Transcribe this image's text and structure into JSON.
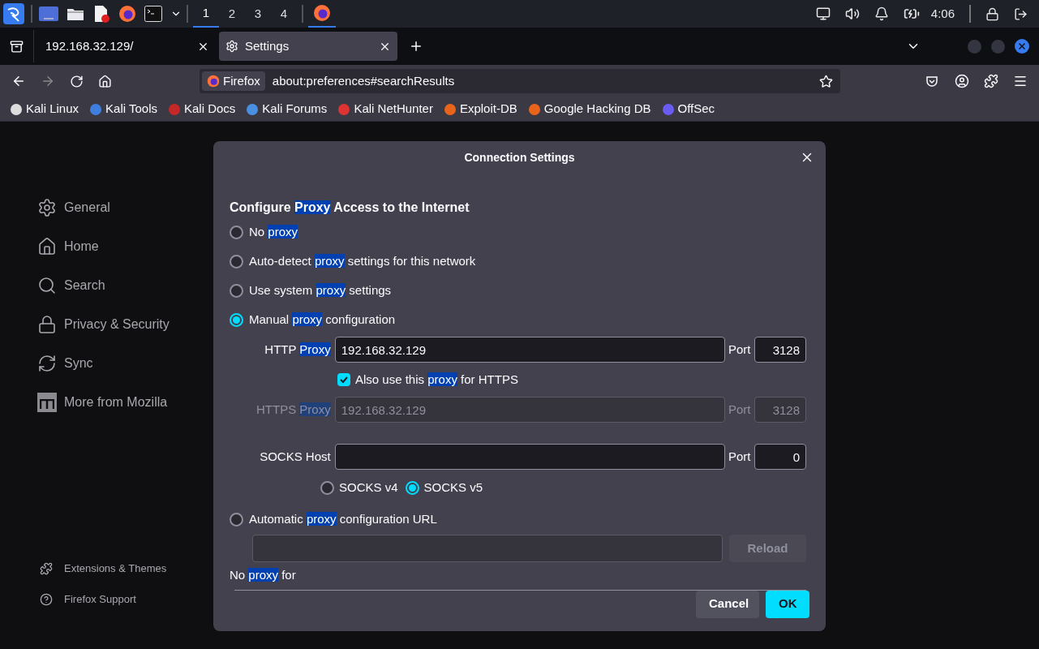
{
  "taskbar": {
    "workspaces": [
      {
        "label": "1",
        "selected": true
      },
      {
        "label": "2",
        "selected": false
      },
      {
        "label": "3",
        "selected": false
      },
      {
        "label": "4",
        "selected": false
      }
    ],
    "clock": "4:06"
  },
  "tabs": [
    {
      "title": "192.168.32.129/",
      "selected": false,
      "kind": "page"
    },
    {
      "title": "Settings",
      "selected": true,
      "kind": "settings"
    }
  ],
  "urlbar": {
    "identity": "Firefox",
    "url": "about:preferences#searchResults"
  },
  "bookmarks": [
    {
      "label": "Kali Linux"
    },
    {
      "label": "Kali Tools"
    },
    {
      "label": "Kali Docs"
    },
    {
      "label": "Kali Forums"
    },
    {
      "label": "Kali NetHunter"
    },
    {
      "label": "Exploit-DB"
    },
    {
      "label": "Google Hacking DB"
    },
    {
      "label": "OffSec"
    }
  ],
  "sidebar": {
    "items": [
      {
        "label": "General"
      },
      {
        "label": "Home"
      },
      {
        "label": "Search"
      },
      {
        "label": "Privacy & Security"
      },
      {
        "label": "Sync"
      },
      {
        "label": "More from Mozilla"
      }
    ],
    "footer": [
      {
        "label": "Extensions & Themes"
      },
      {
        "label": "Firefox Support"
      }
    ]
  },
  "dialog": {
    "title": "Connection Settings",
    "heading": [
      {
        "text": "Configure "
      },
      {
        "text": "Proxy",
        "highlight": true
      },
      {
        "text": " Access to the Internet"
      }
    ],
    "options": [
      {
        "kind": "plain",
        "selected": false,
        "parts": [
          {
            "text": "No "
          },
          {
            "text": "proxy",
            "highlight": true
          }
        ]
      },
      {
        "kind": "plain",
        "selected": false,
        "parts": [
          {
            "text": "Auto-detect "
          },
          {
            "text": "proxy",
            "highlight": true
          },
          {
            "text": " settings for this network"
          }
        ]
      },
      {
        "kind": "plain",
        "selected": false,
        "parts": [
          {
            "text": "Use system "
          },
          {
            "text": "proxy",
            "highlight": true
          },
          {
            "text": " settings"
          }
        ]
      },
      {
        "kind": "manual",
        "selected": true,
        "parts": [
          {
            "text": "Manual "
          },
          {
            "text": "proxy",
            "highlight": true
          },
          {
            "text": " configuration"
          }
        ]
      },
      {
        "kind": "pac",
        "selected": false,
        "parts": [
          {
            "text": "Automatic "
          },
          {
            "text": "proxy",
            "highlight": true
          },
          {
            "text": " configuration URL"
          }
        ]
      }
    ],
    "http": {
      "label": [
        {
          "text": "HTTP "
        },
        {
          "text": "Proxy",
          "highlight": true
        }
      ],
      "value": "192.168.32.129",
      "port_label": "Port",
      "port": "3128",
      "disabled": false
    },
    "also_https": {
      "checked": true,
      "parts": [
        {
          "text": "Also use this "
        },
        {
          "text": "proxy",
          "highlight": true
        },
        {
          "text": " for HTTPS"
        }
      ]
    },
    "https": {
      "label": [
        {
          "text": "HTTPS "
        },
        {
          "text": "Proxy",
          "highlight": true
        }
      ],
      "value": "192.168.32.129",
      "port_label": "Port",
      "port": "3128",
      "disabled": true
    },
    "socks": {
      "label": [
        {
          "text": "SOCKS Host"
        }
      ],
      "port_label": "Port",
      "port": "0",
      "disabled": false
    },
    "socks_versions": [
      {
        "label": "SOCKS v4",
        "selected": false
      },
      {
        "label": "SOCKS v5",
        "selected": true
      }
    ],
    "pac": {
      "reload": "Reload",
      "disabled": true
    },
    "no_proxy_for": [
      {
        "text": "No "
      },
      {
        "text": "proxy",
        "highlight": true
      },
      {
        "text": " for"
      }
    ],
    "buttons": [
      {
        "label": "Cancel",
        "kind": "secondary"
      },
      {
        "label": "OK",
        "kind": "primary"
      }
    ]
  }
}
